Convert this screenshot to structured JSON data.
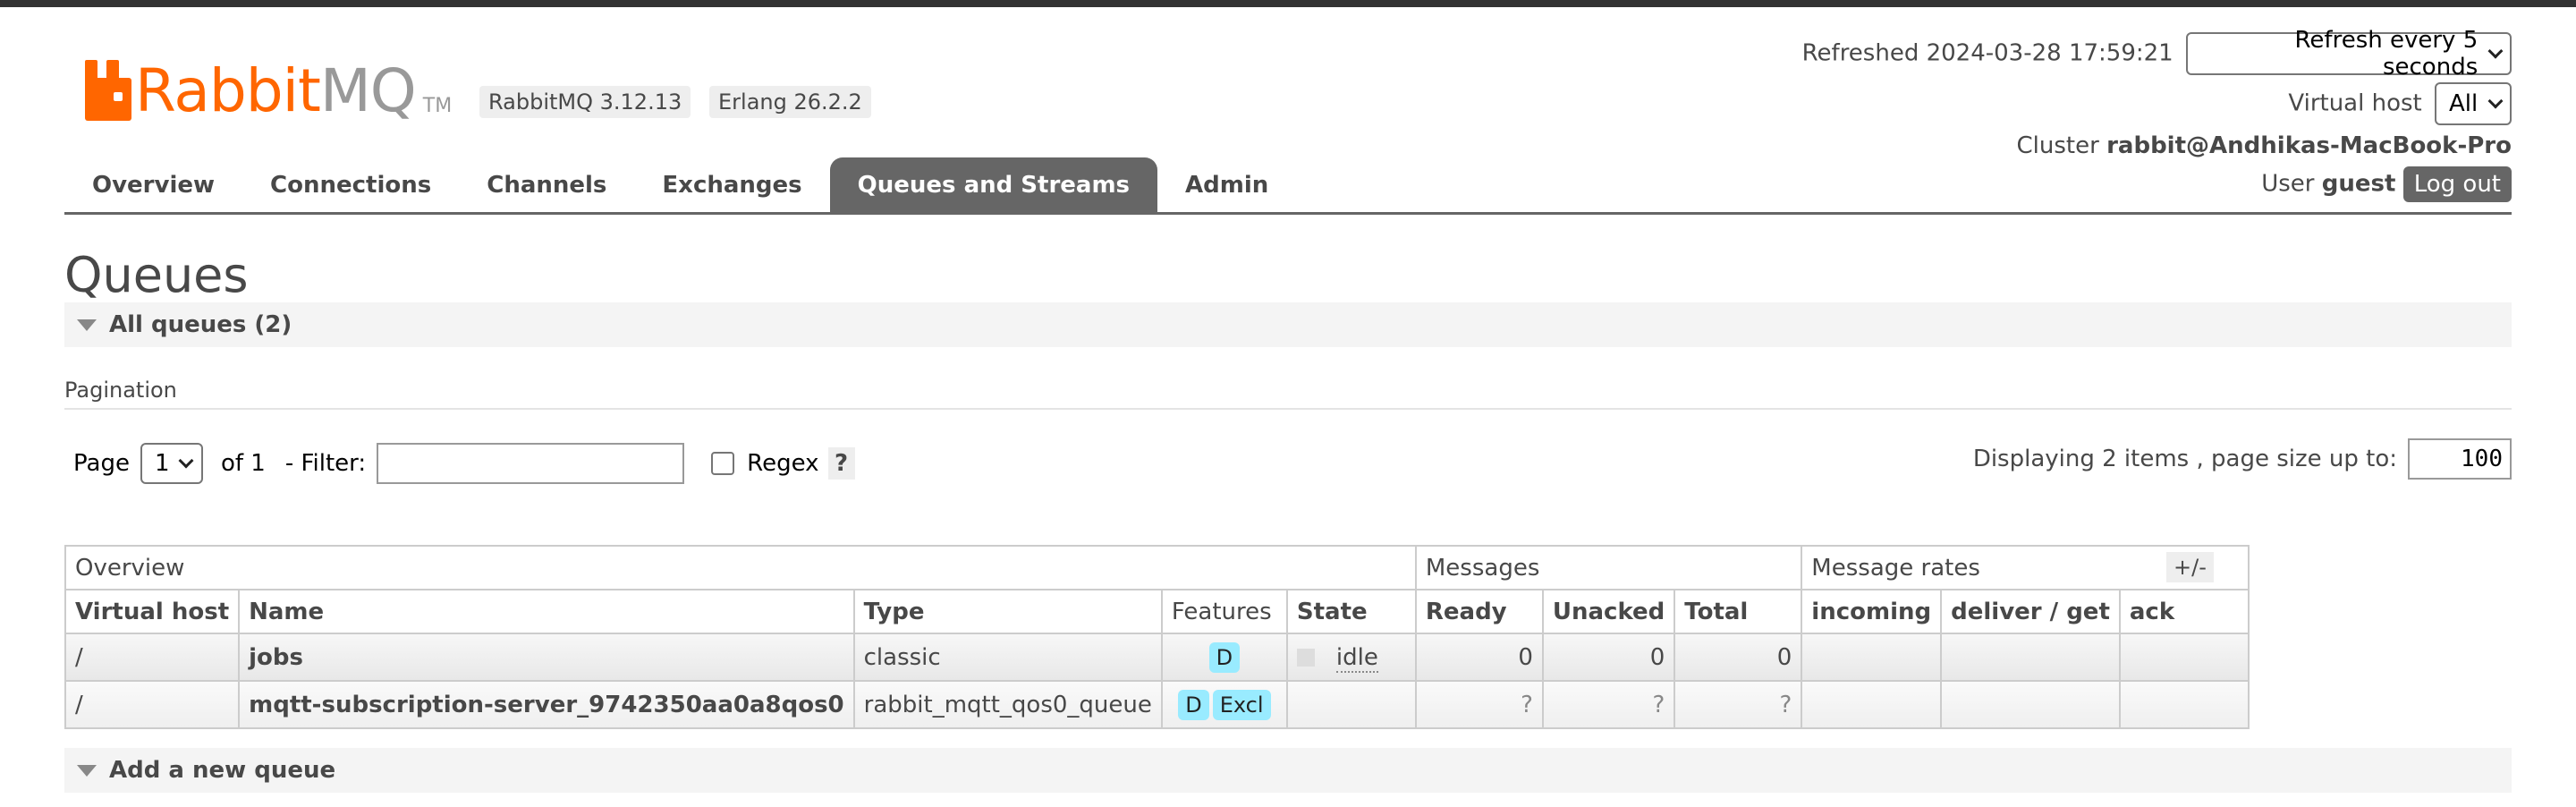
{
  "header": {
    "logo_rabbit": "Rabbit",
    "logo_mq": "MQ",
    "logo_tm": "TM",
    "rabbitmq_version": "RabbitMQ 3.12.13",
    "erlang_version": "Erlang 26.2.2",
    "refreshed_label": "Refreshed 2024-03-28 17:59:21",
    "refresh_select": "Refresh every 5 seconds",
    "vhost_label": "Virtual host",
    "vhost_select": "All",
    "cluster_label": "Cluster",
    "cluster_name": "rabbit@Andhikas-MacBook-Pro",
    "user_label": "User",
    "user_name": "guest",
    "logout_label": "Log out"
  },
  "tabs": [
    {
      "label": "Overview",
      "active": false
    },
    {
      "label": "Connections",
      "active": false
    },
    {
      "label": "Channels",
      "active": false
    },
    {
      "label": "Exchanges",
      "active": false
    },
    {
      "label": "Queues and Streams",
      "active": true
    },
    {
      "label": "Admin",
      "active": false
    }
  ],
  "page": {
    "title": "Queues",
    "all_queues_label": "All queues (2)",
    "pagination_label": "Pagination",
    "page_label": "Page",
    "page_value": "1",
    "of_label": "of 1",
    "filter_label": "- Filter:",
    "filter_value": "",
    "regex_label": "Regex",
    "help_label": "?",
    "displaying_label": "Displaying 2 items , page size up to:",
    "page_size": "100",
    "add_queue_label": "Add a new queue"
  },
  "table": {
    "group_headers": [
      "Overview",
      "Messages",
      "Message rates"
    ],
    "plus_minus": "+/-",
    "columns": [
      "Virtual host",
      "Name",
      "Type",
      "Features",
      "State",
      "Ready",
      "Unacked",
      "Total",
      "incoming",
      "deliver / get",
      "ack"
    ],
    "rows": [
      {
        "vhost": "/",
        "name": "jobs",
        "type": "classic",
        "features": [
          "D"
        ],
        "state": "idle",
        "ready": "0",
        "unacked": "0",
        "total": "0",
        "incoming": "",
        "deliver_get": "",
        "ack": ""
      },
      {
        "vhost": "/",
        "name": "mqtt-subscription-server_9742350aa0a8qos0",
        "type": "rabbit_mqtt_qos0_queue",
        "features": [
          "D",
          "Excl"
        ],
        "state": "",
        "ready": "?",
        "unacked": "?",
        "total": "?",
        "incoming": "",
        "deliver_get": "",
        "ack": ""
      }
    ]
  },
  "colors": {
    "brand_orange": "#ff6600",
    "tab_active": "#666666",
    "feature_badge": "#99ebff"
  }
}
